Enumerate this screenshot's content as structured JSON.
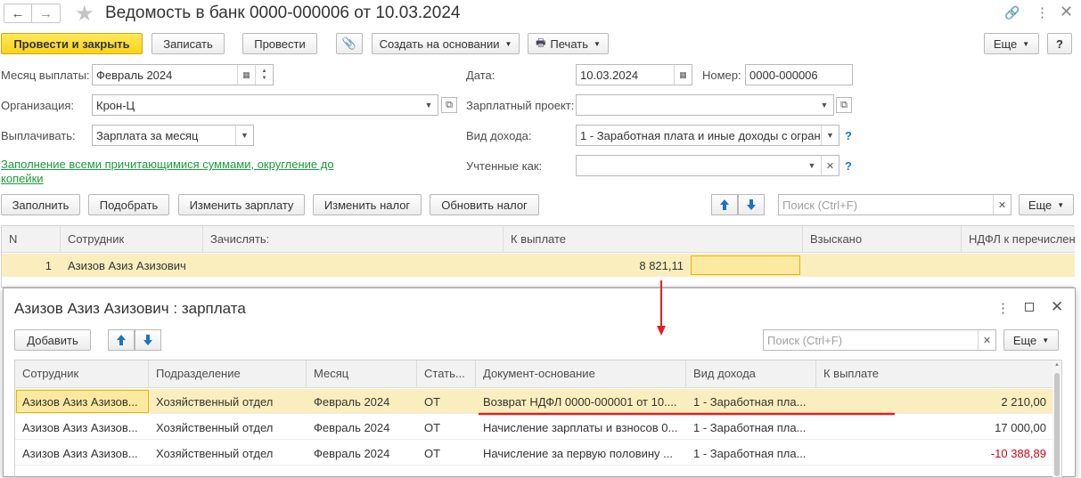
{
  "window": {
    "title": "Ведомость в банк 0000-000006 от 10.03.2024"
  },
  "toolbar": {
    "post_close": "Провести и закрыть",
    "save": "Записать",
    "post": "Провести",
    "create_based": "Создать на основании",
    "print": "Печать",
    "more": "Еще",
    "help": "?"
  },
  "form": {
    "month_label": "Месяц выплаты:",
    "month_value": "Февраль 2024",
    "date_label": "Дата:",
    "date_value": "10.03.2024",
    "number_label": "Номер:",
    "number_value": "0000-000006",
    "org_label": "Организация:",
    "org_value": "Крон-Ц",
    "salary_project_label": "Зарплатный проект:",
    "salary_project_value": "",
    "pay_label": "Выплачивать:",
    "pay_value": "Зарплата за месяц",
    "income_type_label": "Вид дохода:",
    "income_type_value": "1 - Заработная плата и иные доходы с огран",
    "fill_link_line1": "Заполнение всеми причитающимися суммами, округление до",
    "fill_link_line2": "копейки",
    "accounted_label": "Учтенные как:",
    "accounted_value": "",
    "help_mark": "?"
  },
  "table_toolbar": {
    "fill": "Заполнить",
    "pick": "Подобрать",
    "change_salary": "Изменить зарплату",
    "change_tax": "Изменить налог",
    "update_tax": "Обновить налог",
    "search_placeholder": "Поиск (Ctrl+F)",
    "more": "Еще"
  },
  "main_table": {
    "columns": [
      "N",
      "Сотрудник",
      "Зачислять:",
      "К выплате",
      "Взыскано",
      "НДФЛ к перечислен"
    ],
    "rows": [
      {
        "n": "1",
        "employee": "Азизов Азиз Азизович",
        "credit": "",
        "amount": "8 821,11",
        "collected": "",
        "ndfl": ""
      }
    ]
  },
  "dialog": {
    "title": "Азизов Азиз Азизович : зарплата",
    "add": "Добавить",
    "search_placeholder": "Поиск (Ctrl+F)",
    "more": "Еще",
    "columns": [
      "Сотрудник",
      "Подразделение",
      "Месяц",
      "Стать...",
      "Документ-основание",
      "Вид дохода",
      "К выплате"
    ],
    "rows": [
      {
        "employee": "Азизов Азиз Азизов...",
        "dept": "Хозяйственный отдел",
        "month": "Февраль 2024",
        "article": "ОТ",
        "doc": "Возврат НДФЛ 0000-000001 от 10....",
        "income": "1 - Заработная пла...",
        "amount": "2 210,00"
      },
      {
        "employee": "Азизов Азиз Азизов...",
        "dept": "Хозяйственный отдел",
        "month": "Февраль 2024",
        "article": "ОТ",
        "doc": "Начисление зарплаты и взносов 0...",
        "income": "1 - Заработная пла...",
        "amount": "17 000,00"
      },
      {
        "employee": "Азизов Азиз Азизов...",
        "dept": "Хозяйственный отдел",
        "month": "Февраль 2024",
        "article": "ОТ",
        "doc": "Начисление за первую половину ...",
        "income": "1 - Заработная пла...",
        "amount": "-10 388,89"
      }
    ]
  },
  "colors": {
    "accent_yellow": "#f7d318",
    "row_highlight": "#fbeebe",
    "link_green": "#1b9b3c",
    "negative_red": "#d0021b",
    "annotation_red": "#e02020",
    "arrow_blue": "#1c74c4"
  }
}
